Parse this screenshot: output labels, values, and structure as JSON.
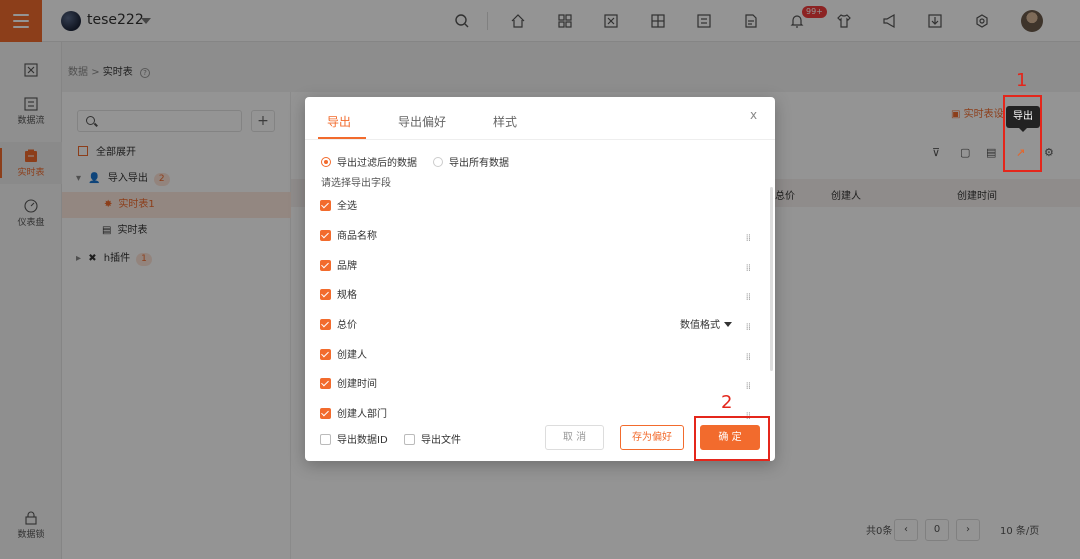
{
  "topbar": {
    "workspace": "tese222",
    "notification_badge": "99+"
  },
  "rail": [
    {
      "icon": "dashboard-icon",
      "label": ""
    },
    {
      "icon": "dataflow-icon",
      "label": "数据流"
    },
    {
      "icon": "realtime-table-icon",
      "label": "实时表"
    },
    {
      "icon": "gauge-icon",
      "label": "仪表盘"
    },
    {
      "icon": "lock-icon",
      "label": "数据锁"
    }
  ],
  "breadcrumb": {
    "root": "数据",
    "sep": ">",
    "current": "实时表"
  },
  "tree": {
    "expand_all": "全部展开",
    "items": [
      {
        "label": "导入导出",
        "count": "2"
      },
      {
        "label": "实时表1"
      },
      {
        "label": "实时表"
      },
      {
        "label": "h插件",
        "count": "1"
      }
    ]
  },
  "main": {
    "title_link": "实时表设",
    "columns": [
      "总价",
      "创建人",
      "创建时间"
    ],
    "pagination": {
      "total": "共0条",
      "page": "0",
      "page_size": "10 条/页"
    }
  },
  "annotations": {
    "num1": "1",
    "num2": "2",
    "tooltip": "导出"
  },
  "modal": {
    "tabs": [
      "导出",
      "导出偏好",
      "样式"
    ],
    "close": "x",
    "radio": [
      "导出过滤后的数据",
      "导出所有数据"
    ],
    "hint": "请选择导出字段",
    "fields": [
      "全选",
      "商品名称",
      "品牌",
      "规格",
      "总价",
      "创建人",
      "创建时间",
      "创建人部门"
    ],
    "number_format": "数值格式",
    "options": [
      "导出数据ID",
      "导出文件"
    ],
    "buttons": {
      "cancel": "取 消",
      "save": "存为偏好",
      "ok": "确 定"
    }
  },
  "colors": {
    "accent": "#f26b2d",
    "annotation_red": "#e4261b"
  }
}
